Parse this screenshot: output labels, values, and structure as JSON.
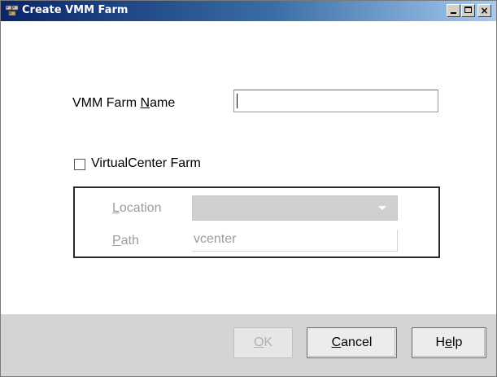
{
  "window": {
    "title": "Create VMM Farm",
    "controls": {
      "minimize": "_",
      "maximize": "□",
      "close": "×"
    }
  },
  "form": {
    "farm_name": {
      "label_pre": "VMM Farm ",
      "label_mnemonic": "N",
      "label_post": "ame",
      "value": ""
    },
    "virtualcenter": {
      "label": "VirtualCenter Farm",
      "checked": false
    },
    "location": {
      "label_mnemonic": "L",
      "label_post": "ocation",
      "selected": ""
    },
    "path": {
      "label_mnemonic": "P",
      "label_post": "ath",
      "value": "vcenter"
    }
  },
  "footer": {
    "ok": {
      "mnemonic": "O",
      "post": "K",
      "enabled": false
    },
    "cancel": {
      "mnemonic": "C",
      "post": "ancel"
    },
    "help": {
      "pre": "H",
      "mnemonic": "e",
      "post": "lp"
    }
  },
  "icons": {
    "app": "vmm-farm-icon",
    "dropdown": "chevron-down-icon"
  },
  "colors": {
    "titlebar_start": "#0a246a",
    "titlebar_end": "#a6caf0",
    "footer_bg": "#d4d4d4",
    "disabled_text": "#9c9c9c"
  }
}
